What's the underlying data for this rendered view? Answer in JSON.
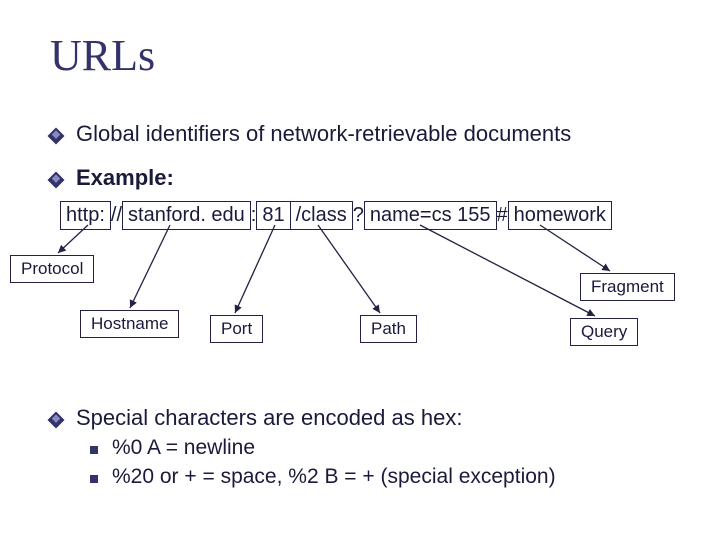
{
  "title": "URLs",
  "bullets": {
    "b1": "Global identifiers of network-retrievable documents",
    "b2": "Example:",
    "b3": "Special characters are encoded as hex:",
    "sub1": "%0 A = newline",
    "sub2": "%20 or + = space, %2 B = +  (special exception)"
  },
  "url": {
    "protocol": "http:",
    "sep1": "//",
    "hostname": "stanford. edu",
    "sep2": ":",
    "port": "81",
    "path": "/class",
    "sep3": "?",
    "query": "name=cs 155",
    "sep4": "#",
    "fragment": "homework"
  },
  "labels": {
    "protocol": "Protocol",
    "fragment": "Fragment",
    "hostname": "Hostname",
    "port": "Port",
    "path": "Path",
    "query": "Query"
  }
}
